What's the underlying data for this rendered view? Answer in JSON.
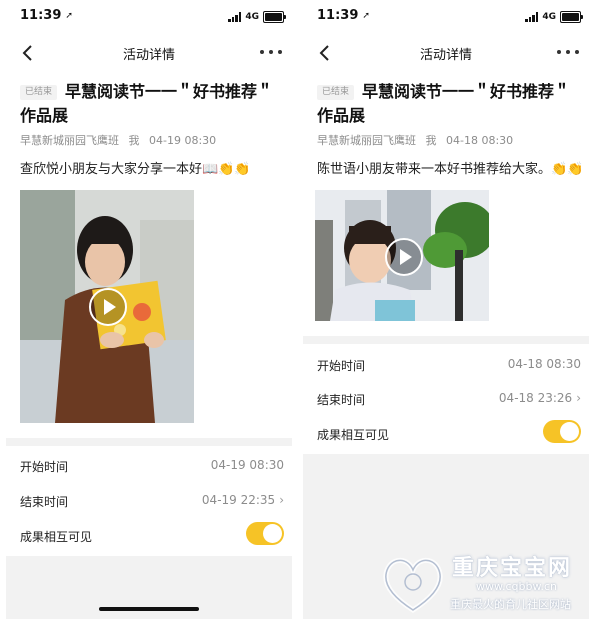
{
  "status_bar": {
    "time": "11:39",
    "network": "4G"
  },
  "nav": {
    "title": "活动详情"
  },
  "left": {
    "badge": "已结束",
    "title": "早慧阅读节一一＂好书推荐＂作品展",
    "meta": {
      "class_name": "早慧新城丽园飞鹰班",
      "author": "我",
      "datetime": "04-19 08:30"
    },
    "post_text": "查欣悦小朋友与大家分享一本好📖👏👏",
    "settings": {
      "start_label": "开始时间",
      "start_value": "04-19 08:30",
      "end_label": "结束时间",
      "end_value": "04-19 22:35",
      "visible_label": "成果相互可见",
      "visible_on": true
    }
  },
  "right": {
    "badge": "已结束",
    "title": "早慧阅读节一一＂好书推荐＂作品展",
    "meta": {
      "class_name": "早慧新城丽园飞鹰班",
      "author": "我",
      "datetime": "04-18 08:30"
    },
    "post_text": "陈世语小朋友带来一本好书推荐给大家。👏👏",
    "settings": {
      "start_label": "开始时间",
      "start_value": "04-18 08:30",
      "end_label": "结束时间",
      "end_value": "04-18 23:26",
      "visible_label": "成果相互可见",
      "visible_on": true
    }
  },
  "watermark": {
    "title": "重庆宝宝网",
    "url": "www.cqbbw.cn",
    "tagline": "重庆最火的育儿社区网站"
  },
  "colors": {
    "toggle": "#f6c326",
    "divider": "#f2f2f2",
    "meta_text": "#8c8c8c"
  }
}
